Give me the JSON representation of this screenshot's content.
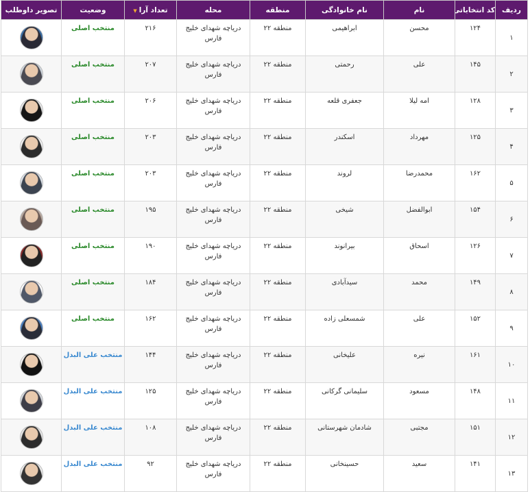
{
  "table": {
    "headers": {
      "row": "ردیف",
      "code": "کد انتخاباتی",
      "first_name": "نام",
      "last_name": "نام خانوادگی",
      "region": "منطقه",
      "area": "محله",
      "votes": "تعداد آرا",
      "status": "وضعیت",
      "photo": "تصویر داوطلب"
    },
    "sort_indicator": "▼",
    "rows": [
      {
        "row": "۱",
        "code": "۱۲۴",
        "first_name": "محسن",
        "last_name": "ابراهیمی",
        "region": "منطقه ۲۲",
        "area": "دریاچه شهدای خلیج فارس",
        "votes": "۲۱۶",
        "status": "منتخب اصلی",
        "status_kind": "main",
        "avatar_bg": "#3a6ea5",
        "avatar_suit": "#2a2a35"
      },
      {
        "row": "۲",
        "code": "۱۴۵",
        "first_name": "علی",
        "last_name": "رحمتی",
        "region": "منطقه ۲۲",
        "area": "دریاچه شهدای خلیج فارس",
        "votes": "۲۰۷",
        "status": "منتخب اصلی",
        "status_kind": "main",
        "avatar_bg": "#cfd6dd",
        "avatar_suit": "#4a4a52"
      },
      {
        "row": "۳",
        "code": "۱۲۸",
        "first_name": "امه لیلا",
        "last_name": "جعفری قلعه",
        "region": "منطقه ۲۲",
        "area": "دریاچه شهدای خلیج فارس",
        "votes": "۲۰۶",
        "status": "منتخب اصلی",
        "status_kind": "main",
        "avatar_bg": "#e9e9e9",
        "avatar_suit": "#151515"
      },
      {
        "row": "۴",
        "code": "۱۲۵",
        "first_name": "مهرداد",
        "last_name": "اسکندر",
        "region": "منطقه ۲۲",
        "area": "دریاچه شهدای خلیج فارس",
        "votes": "۲۰۳",
        "status": "منتخب اصلی",
        "status_kind": "main",
        "avatar_bg": "#f2f2f2",
        "avatar_suit": "#2b2b2b"
      },
      {
        "row": "۵",
        "code": "۱۶۲",
        "first_name": "محمدرضا",
        "last_name": "لروند",
        "region": "منطقه ۲۲",
        "area": "دریاچه شهدای خلیج فارس",
        "votes": "۲۰۳",
        "status": "منتخب اصلی",
        "status_kind": "main",
        "avatar_bg": "#dfe4ea",
        "avatar_suit": "#3c4450"
      },
      {
        "row": "۶",
        "code": "۱۵۴",
        "first_name": "ابوالفضل",
        "last_name": "شیخی",
        "region": "منطقه ۲۲",
        "area": "دریاچه شهدای خلیج فارس",
        "votes": "۱۹۵",
        "status": "منتخب اصلی",
        "status_kind": "main",
        "avatar_bg": "#b8a9a0",
        "avatar_suit": "#6a5a55"
      },
      {
        "row": "۷",
        "code": "۱۲۶",
        "first_name": "اسحاق",
        "last_name": "بیرانوند",
        "region": "منطقه ۲۲",
        "area": "دریاچه شهدای خلیج فارس",
        "votes": "۱۹۰",
        "status": "منتخب اصلی",
        "status_kind": "main",
        "avatar_bg": "#8a2a2a",
        "avatar_suit": "#222"
      },
      {
        "row": "۸",
        "code": "۱۴۹",
        "first_name": "محمد",
        "last_name": "سیدآبادی",
        "region": "منطقه ۲۲",
        "area": "دریاچه شهدای خلیج فارس",
        "votes": "۱۸۴",
        "status": "منتخب اصلی",
        "status_kind": "main",
        "avatar_bg": "#ffffff",
        "avatar_suit": "#505868"
      },
      {
        "row": "۹",
        "code": "۱۵۲",
        "first_name": "علی",
        "last_name": "شمسعلی زاده",
        "region": "منطقه ۲۲",
        "area": "دریاچه شهدای خلیج فارس",
        "votes": "۱۶۲",
        "status": "منتخب اصلی",
        "status_kind": "main",
        "avatar_bg": "#4a7fc0",
        "avatar_suit": "#2a2d38"
      },
      {
        "row": "۱۰",
        "code": "۱۶۱",
        "first_name": "نیره",
        "last_name": "علیخانی",
        "region": "منطقه ۲۲",
        "area": "دریاچه شهدای خلیج فارس",
        "votes": "۱۴۴",
        "status": "منتخب علی البدل",
        "status_kind": "alt",
        "avatar_bg": "#f4f4f4",
        "avatar_suit": "#111"
      },
      {
        "row": "۱۱",
        "code": "۱۴۸",
        "first_name": "مسعود",
        "last_name": "سلیمانی گرکانی",
        "region": "منطقه ۲۲",
        "area": "دریاچه شهدای خلیج فارس",
        "votes": "۱۲۵",
        "status": "منتخب علی البدل",
        "status_kind": "alt",
        "avatar_bg": "#d7dbe0",
        "avatar_suit": "#3e3e48"
      },
      {
        "row": "۱۲",
        "code": "۱۵۱",
        "first_name": "مجتبی",
        "last_name": "شادمان شهرستانی",
        "region": "منطقه ۲۲",
        "area": "دریاچه شهدای خلیج فارس",
        "votes": "۱۰۸",
        "status": "منتخب علی البدل",
        "status_kind": "alt",
        "avatar_bg": "#e6e6e6",
        "avatar_suit": "#2c2c2c"
      },
      {
        "row": "۱۳",
        "code": "۱۴۱",
        "first_name": "سعید",
        "last_name": "حسینخانی",
        "region": "منطقه ۲۲",
        "area": "دریاچه شهدای خلیج فارس",
        "votes": "۹۲",
        "status": "منتخب علی البدل",
        "status_kind": "alt",
        "avatar_bg": "#eeeeee",
        "avatar_suit": "#333"
      }
    ]
  }
}
